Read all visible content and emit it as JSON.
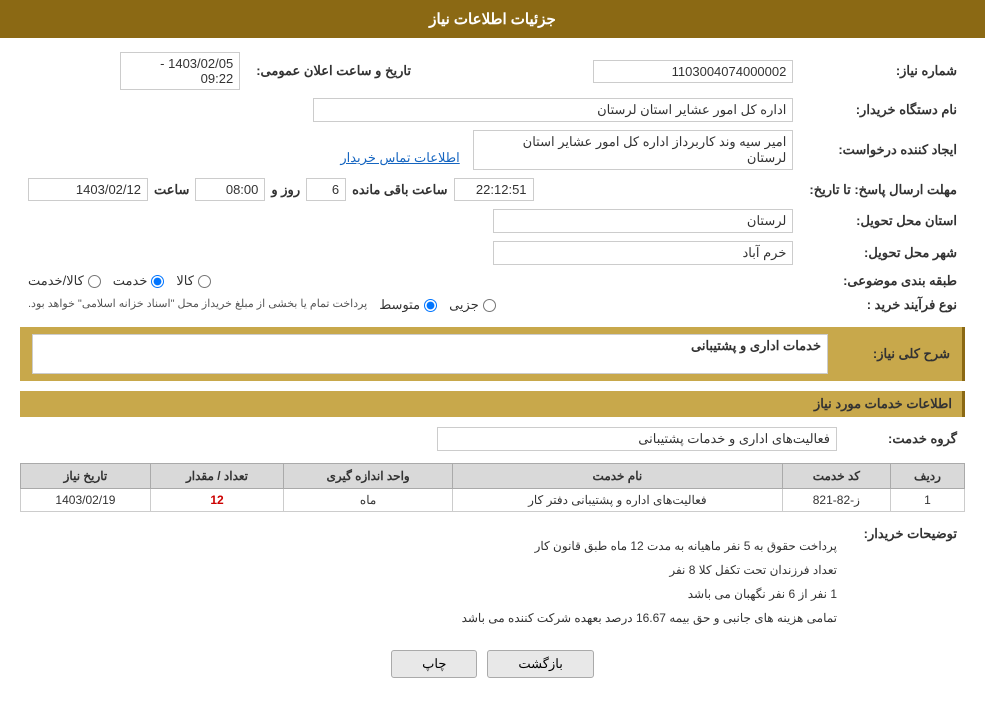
{
  "header": {
    "title": "جزئیات اطلاعات نیاز"
  },
  "fields": {
    "request_number_label": "شماره نیاز:",
    "request_number_value": "1103004074000002",
    "buyer_org_label": "نام دستگاه خریدار:",
    "buyer_org_value": "اداره کل امور عشایر استان لرستان",
    "creator_label": "ایجاد کننده درخواست:",
    "creator_value": "امیر سیه وند کاربرداز اداره کل امور عشایر استان لرستان",
    "buyer_contact_link": "اطلاعات تماس خریدار",
    "response_deadline_label": "مهلت ارسال پاسخ: تا تاریخ:",
    "response_date": "1403/02/12",
    "response_time_label": "ساعت",
    "response_time": "08:00",
    "response_days_label": "روز و",
    "response_days": "6",
    "response_remaining_label": "ساعت باقی مانده",
    "response_time_remaining": "22:12:51",
    "announcement_label": "تاریخ و ساعت اعلان عمومی:",
    "announcement_value": "1403/02/05 - 09:22",
    "province_label": "استان محل تحویل:",
    "province_value": "لرستان",
    "city_label": "شهر محل تحویل:",
    "city_value": "خرم آباد",
    "category_label": "طبقه بندی موضوعی:",
    "category_options": [
      "کالا",
      "خدمت",
      "کالا/خدمت"
    ],
    "category_selected": "خدمت",
    "purchase_type_label": "نوع فرآیند خرید :",
    "purchase_type_options": [
      "جزیی",
      "متوسط"
    ],
    "purchase_type_note": "پرداخت تمام یا بخشی از مبلغ خریداز محل \"اسناد خزانه اسلامی\" خواهد بود.",
    "purchase_type_selected": "متوسط",
    "description_label": "شرح کلی نیاز:",
    "description_value": "خدمات اداری و پشتیبانی",
    "services_section_label": "اطلاعات خدمات مورد نیاز",
    "service_group_label": "گروه خدمت:",
    "service_group_value": "فعالیت‌های اداری و خدمات پشتیبانی",
    "table": {
      "headers": [
        "ردیف",
        "کد خدمت",
        "نام خدمت",
        "واحد اندازه گیری",
        "تعداد / مقدار",
        "تاریخ نیاز"
      ],
      "rows": [
        {
          "row": "1",
          "code": "ز-82-821",
          "name": "فعالیت‌های اداره و پشتیبانی دفتر کار",
          "unit": "ماه",
          "quantity": "12",
          "date": "1403/02/19"
        }
      ]
    },
    "buyer_notes_label": "توضیحات خریدار:",
    "buyer_notes_lines": [
      "پرداخت حقوق به 5 نفر ماهیانه به مدت 12 ماه طبق قانون کار",
      "تعداد فرزندان تحت تکفل کلا 8 نفر",
      "1 نفر از 6 نفر نگهبان می باشد",
      "تمامی هزینه های جانبی و حق بیمه 16.67 درصد بعهده شرکت کننده می باشد"
    ],
    "btn_print": "چاپ",
    "btn_back": "بازگشت"
  }
}
